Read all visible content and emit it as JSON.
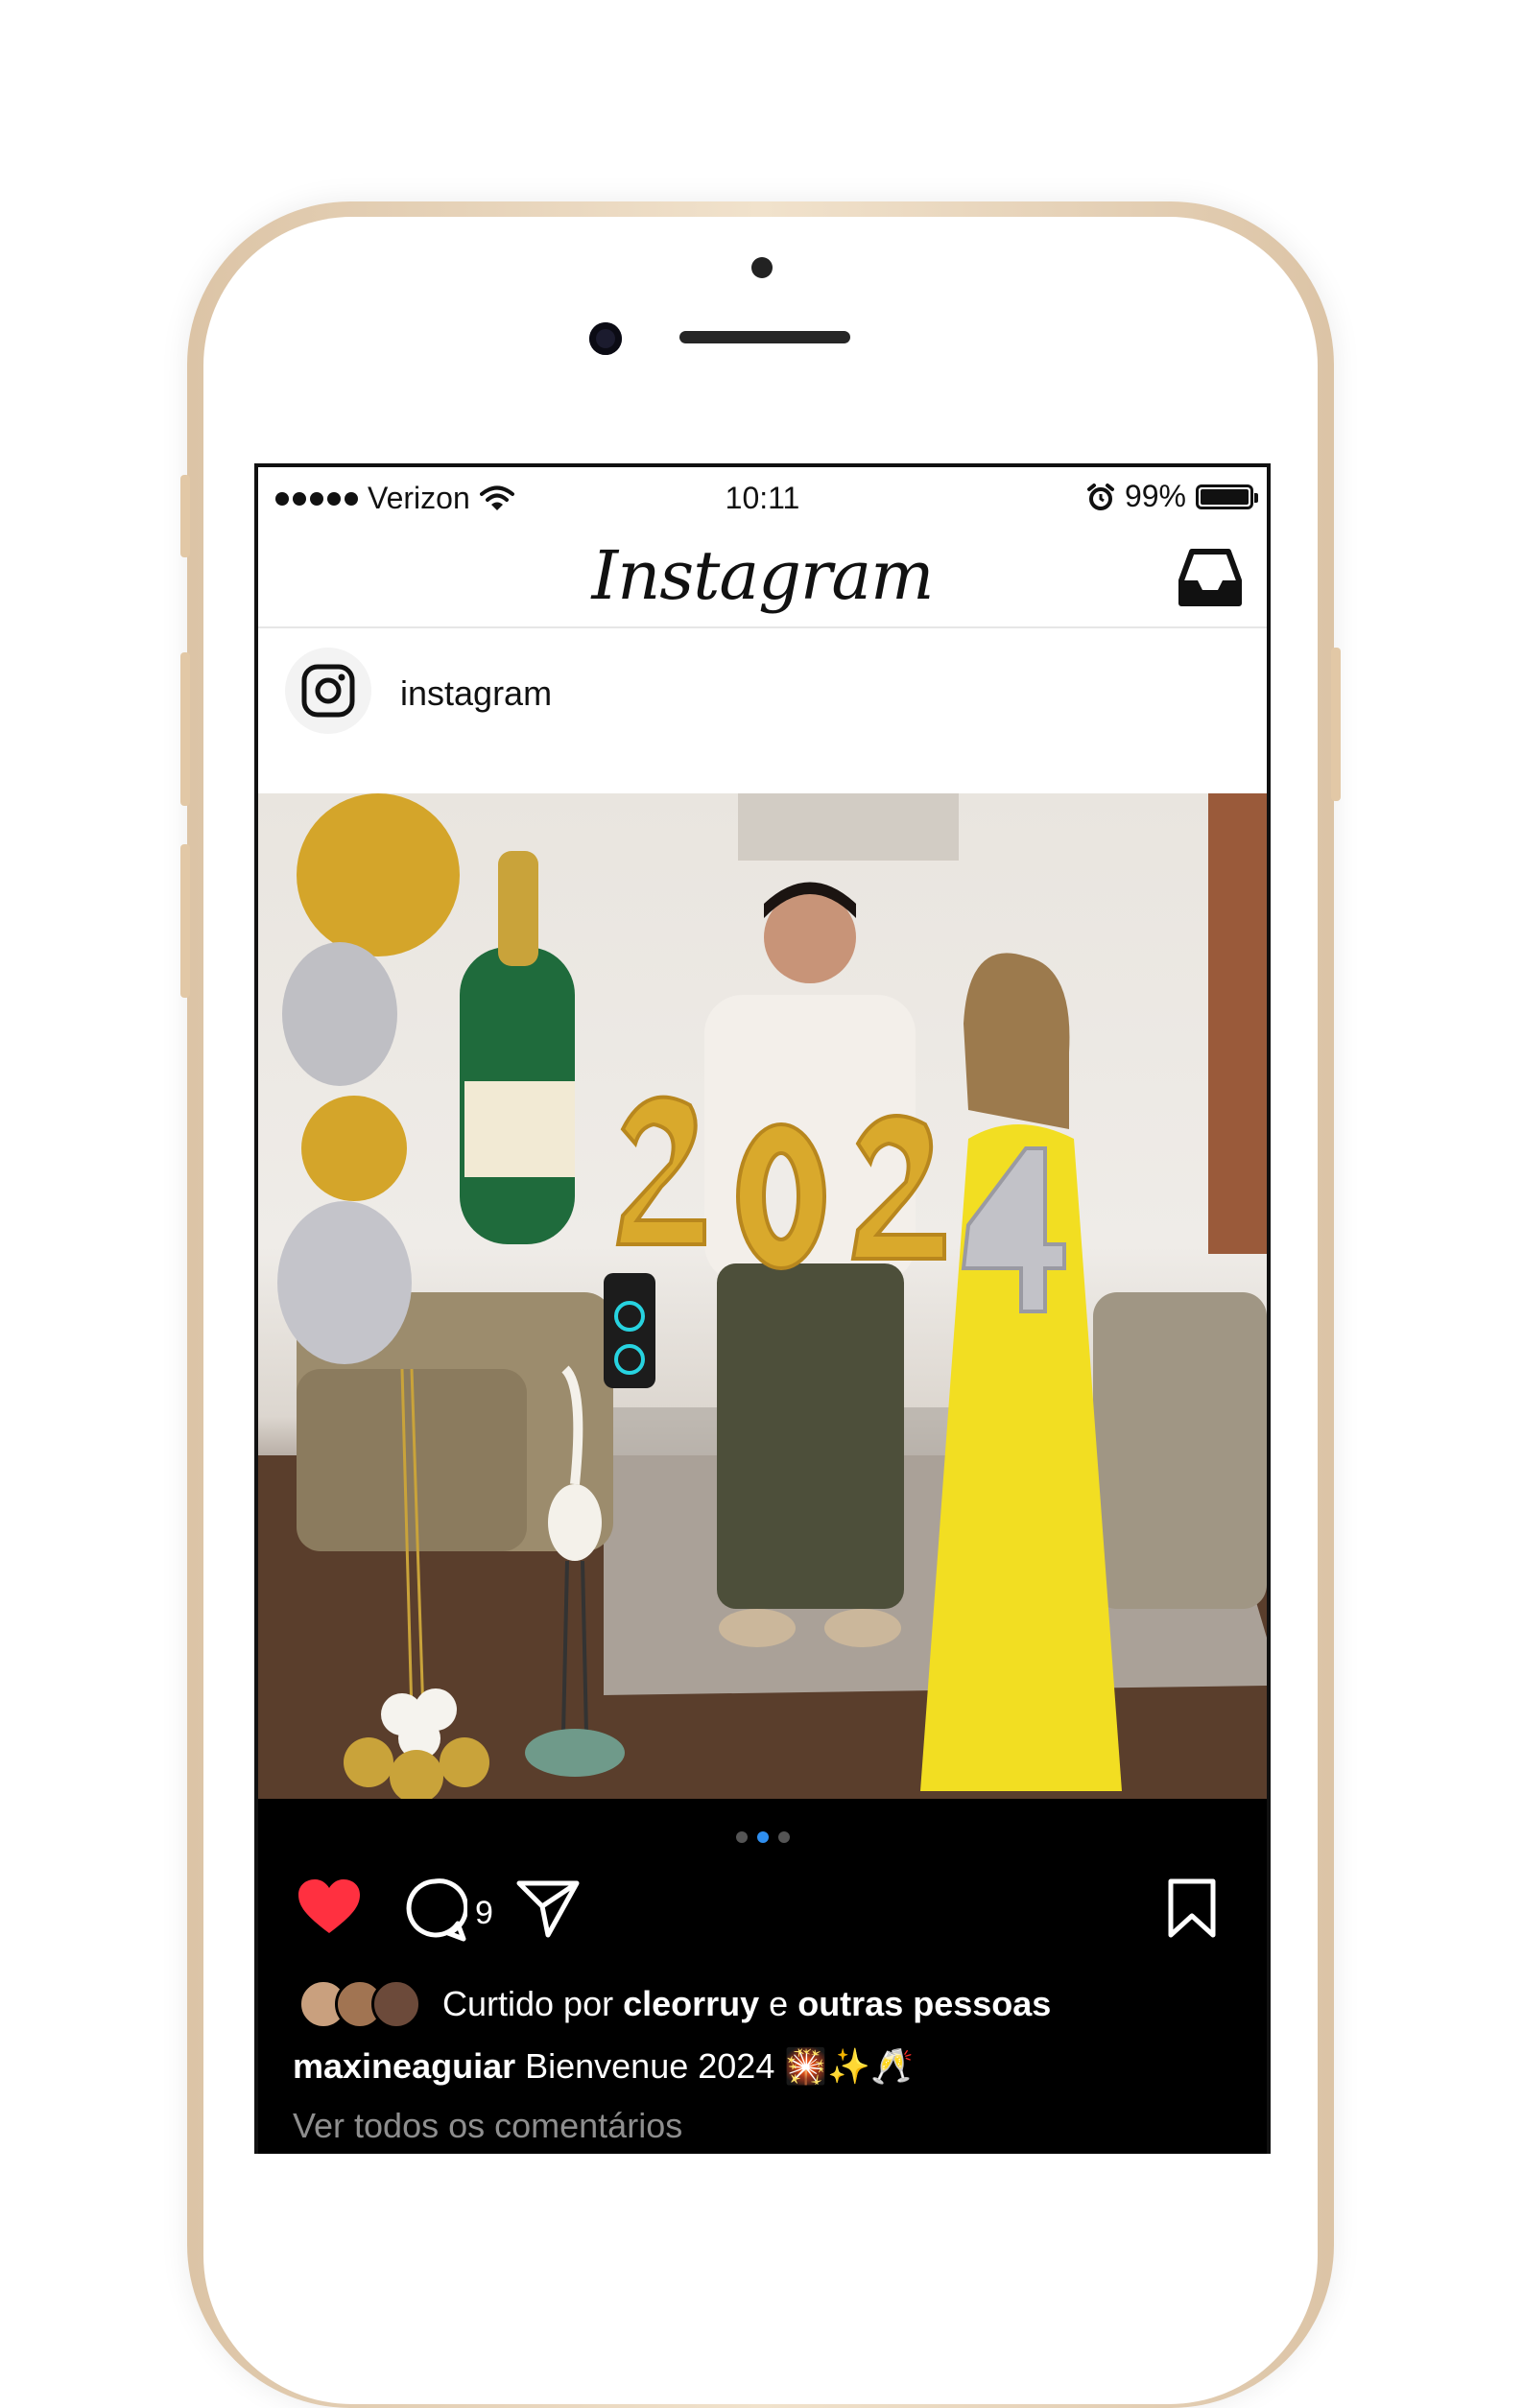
{
  "status_bar": {
    "carrier": "Verizon",
    "time": "10:11",
    "battery": "99%"
  },
  "header": {
    "logo_text": "Instagram",
    "inbox_icon": "inbox-icon"
  },
  "post": {
    "username": "instagram",
    "avatar_icon": "instagram-glyph-icon",
    "carousel": {
      "count": 3,
      "active_index": 1
    },
    "balloons_text": "2024",
    "comment_count": "9",
    "liked": true,
    "likes": {
      "prefix": "Curtido por ",
      "user": "cleorruy",
      "middle": " e ",
      "others": "outras pessoas"
    },
    "caption": {
      "user": "maxineaguiar",
      "text": " Bienvenue 2024 🎇✨🥂"
    },
    "view_comments": "Ver todos os comentários"
  },
  "colors": {
    "like_red": "#ff3040",
    "carousel_active": "#2f8ff0",
    "dress_yellow": "#f2de22",
    "balloon_gold": "#d9a92c"
  }
}
